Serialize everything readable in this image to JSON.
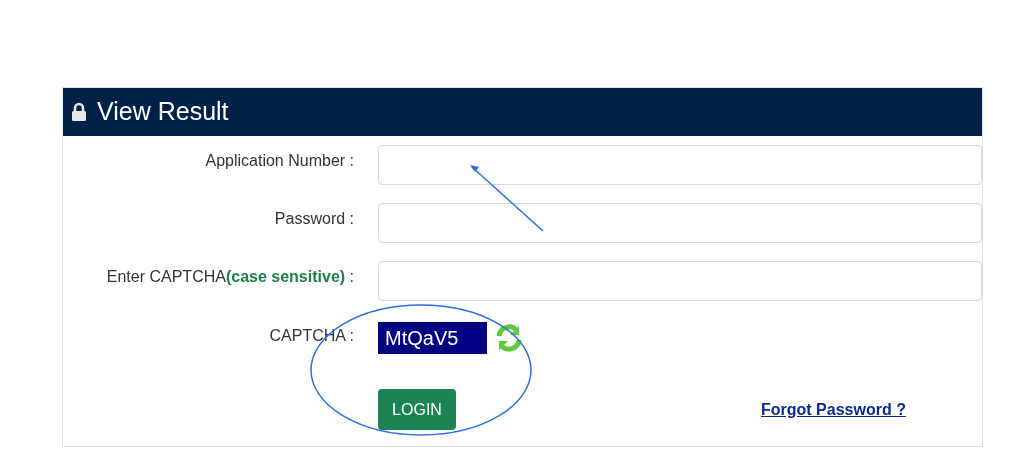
{
  "panel": {
    "title": "View Result"
  },
  "fields": [
    {
      "label": "Application Number :"
    },
    {
      "label": "Password :"
    },
    {
      "label": "Enter CAPTCHA**(case sensitive)** :"
    }
  ],
  "captcha": {
    "label": "CAPTCHA :",
    "code": "MtQaV5"
  },
  "login_button": "LOGIN",
  "forgot_link": "Forgot Password ?"
}
